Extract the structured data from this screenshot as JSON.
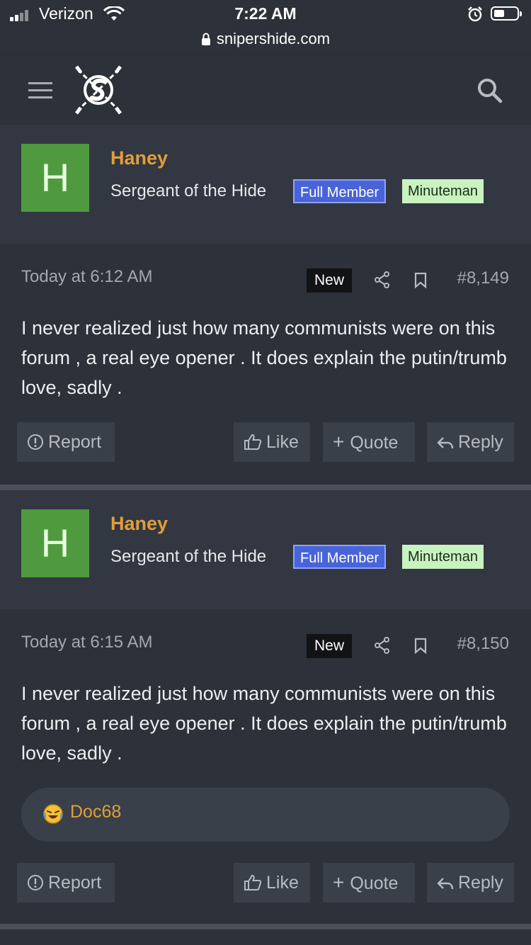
{
  "status_bar": {
    "carrier": "Verizon",
    "time": "7:22 AM",
    "url": "snipershide.com"
  },
  "header": {
    "menu_icon": "hamburger-menu-icon",
    "logo_icon": "snipershide-logo-icon",
    "search_icon": "search-icon"
  },
  "colors": {
    "username": "#e09e3a",
    "full_member_badge": "#4964d8",
    "minuteman_badge": "#c8f2c0",
    "avatar": "#4f9a3f"
  },
  "posts": [
    {
      "avatar_letter": "H",
      "username": "Haney",
      "user_title": "Sergeant of the Hide",
      "badges": [
        "Full Member",
        "Minuteman"
      ],
      "date": "Today at 6:12 AM",
      "new_label": "New",
      "post_number": "#8,149",
      "text": "I never realized just how many communists were on this forum , a real eye opener . It does explain the putin/trumb love, sadly .",
      "actions": {
        "report": "Report",
        "like": "Like",
        "quote": "Quote",
        "reply": "Reply"
      }
    },
    {
      "avatar_letter": "H",
      "username": "Haney",
      "user_title": "Sergeant of the Hide",
      "badges": [
        "Full Member",
        "Minuteman"
      ],
      "date": "Today at 6:15 AM",
      "new_label": "New",
      "post_number": "#8,150",
      "text": "I never realized just how many communists were on this forum , a real eye opener . It does explain the putin/trumb love, sadly .",
      "reaction": {
        "icon": "laughing-emoji-icon",
        "user": "Doc68"
      },
      "actions": {
        "report": "Report",
        "like": "Like",
        "quote": "Quote",
        "reply": "Reply"
      }
    }
  ]
}
